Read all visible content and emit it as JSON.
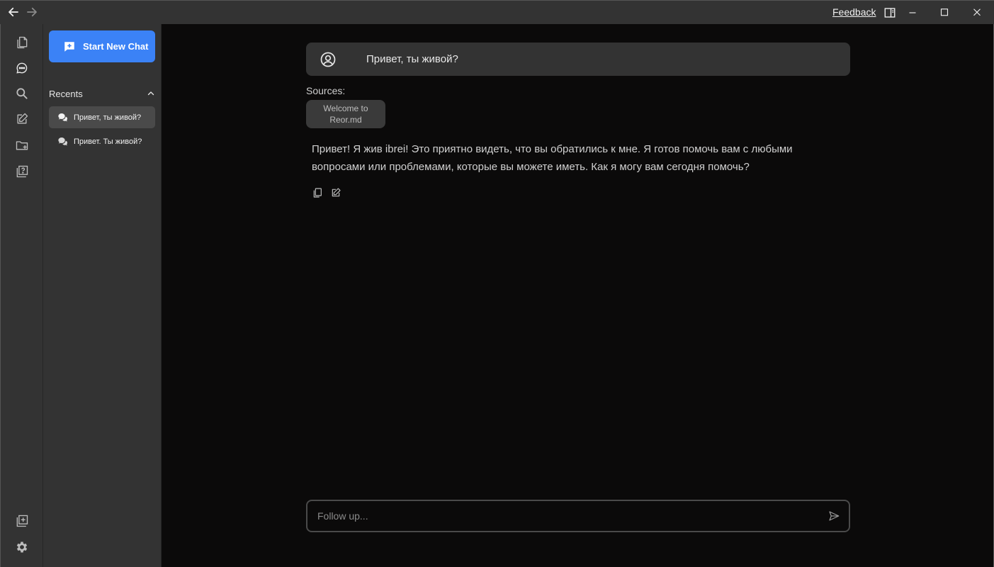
{
  "titlebar": {
    "feedback_label": "Feedback",
    "icons": [
      "arrow-left-icon",
      "arrow-right-icon",
      "sidebar-toggle-icon",
      "minimize-icon",
      "maximize-icon",
      "close-icon"
    ]
  },
  "rail": {
    "icons": [
      "files-icon",
      "chat-icon",
      "search-icon",
      "edit-note-icon",
      "new-folder-icon",
      "help-icon",
      "add-window-icon",
      "settings-icon"
    ]
  },
  "sidebar": {
    "new_chat_label": "Start New Chat",
    "recents_label": "Recents",
    "recents": [
      {
        "label": "Привет, ты живой?",
        "active": true
      },
      {
        "label": "Привет. Ты живой?",
        "active": false
      }
    ]
  },
  "chat": {
    "question": "Привет, ты живой?",
    "sources_label": "Sources:",
    "source_chip": "Welcome to Reor.md",
    "answer": "Привет! Я жив ibrei! Это приятно видеть, что вы обратились к мне. Я готов помочь вам с любыми вопросами или проблемами, которые вы можете иметь. Как я могу вам сегодня помочь?",
    "followup_placeholder": "Follow up..."
  },
  "colors": {
    "accent": "#3b82f6",
    "panel": "#333333",
    "background": "#0b0a0a"
  }
}
